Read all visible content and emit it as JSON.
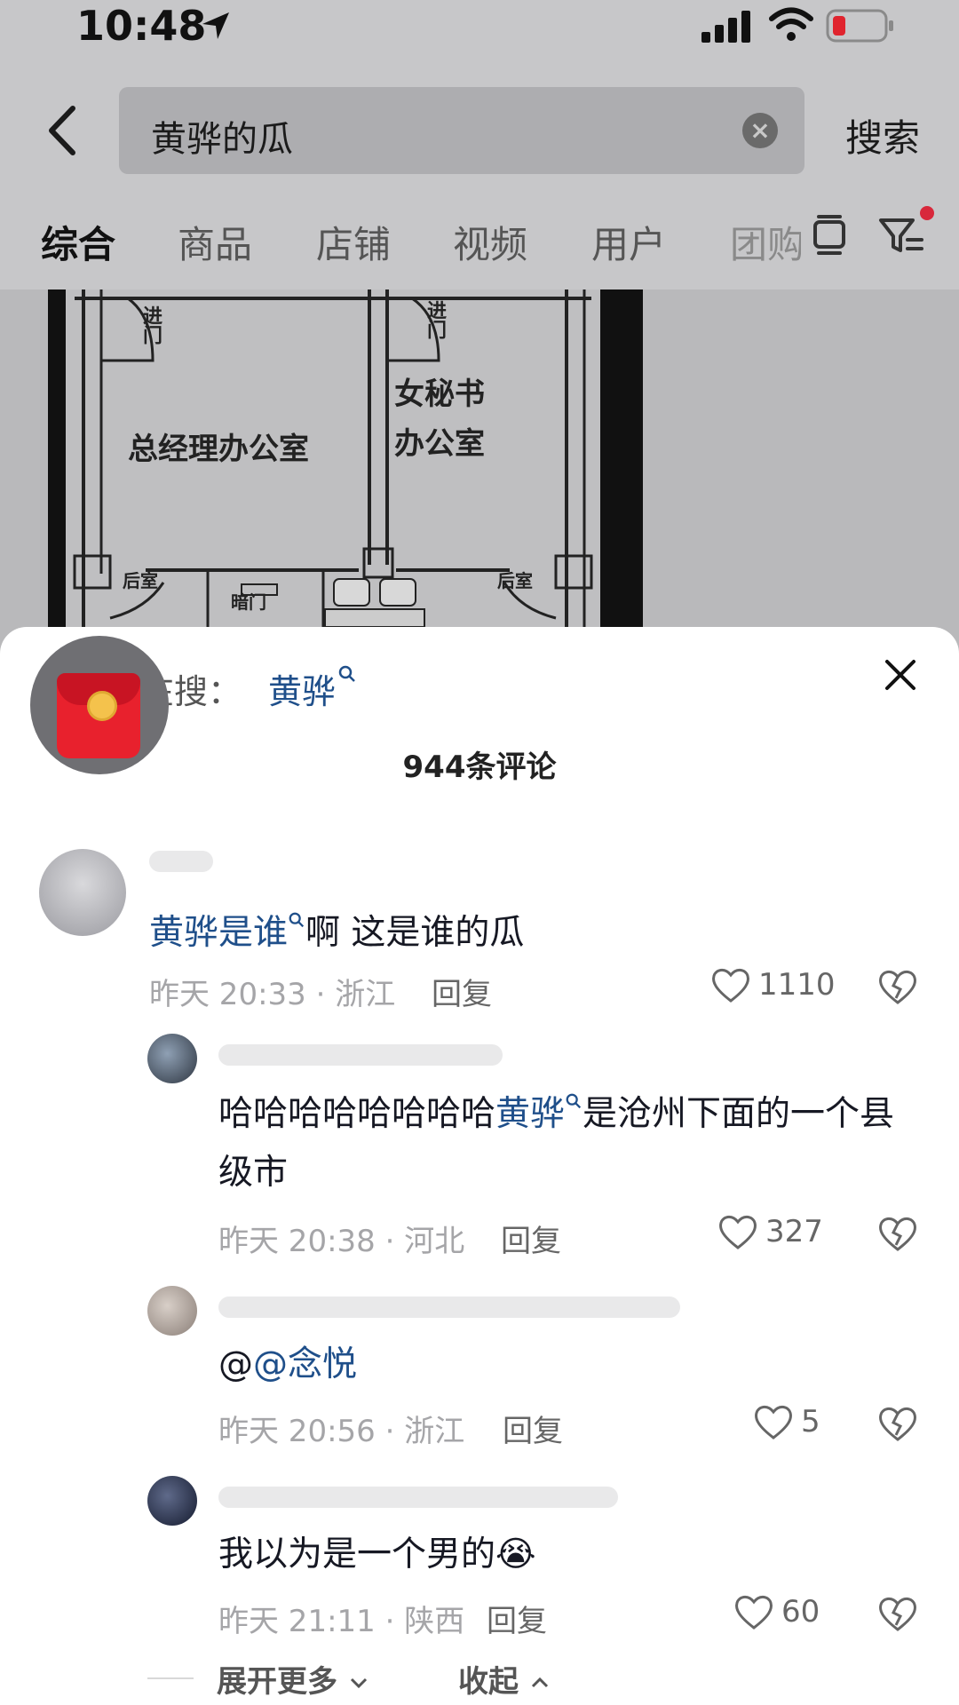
{
  "status": {
    "time": "10:48"
  },
  "search": {
    "query": "黄骅的瓜",
    "submit_label": "搜索"
  },
  "tabs": [
    "综合",
    "商品",
    "店铺",
    "视频",
    "用户",
    "团购"
  ],
  "plan": {
    "labels": [
      "进门",
      "进门",
      "总经理办公室",
      "女秘书",
      "办公室",
      "后室",
      "暗门",
      "后室"
    ]
  },
  "sheet": {
    "hot_prefix": "大家都在搜：",
    "hot_keyword": "黄骅",
    "comment_count": "944条评论"
  },
  "comments": [
    {
      "link": "黄骅是谁",
      "text": "啊 这是谁的瓜",
      "meta": "昨天 20:33 · 浙江",
      "reply": "回复",
      "likes": "1110"
    },
    {
      "prefix": "哈哈哈哈哈哈哈哈",
      "link": "黄骅",
      "text": "是沧州下面的一个县级市",
      "meta": "昨天 20:38 · 河北",
      "reply": "回复",
      "likes": "327"
    },
    {
      "prefix": "@",
      "link": "@念悦",
      "meta": "昨天 20:56 · 浙江",
      "reply": "回复",
      "likes": "5"
    },
    {
      "text": "我以为是一个男的",
      "emoji": "😭",
      "meta": "昨天 21:11 · 陕西",
      "reply": "回复",
      "likes": "60"
    }
  ],
  "footer": {
    "expand": "展开更多",
    "collapse": "收起"
  },
  "icons": {
    "back": "back-chevron-icon",
    "clear": "clear-icon",
    "like": "heart-icon",
    "dislike": "broken-heart-icon",
    "close": "close-icon",
    "filter": "filter-icon"
  },
  "colors": {
    "link": "#1f4f8a",
    "badge": "#d8283b",
    "redpacket": "#e8212d"
  }
}
